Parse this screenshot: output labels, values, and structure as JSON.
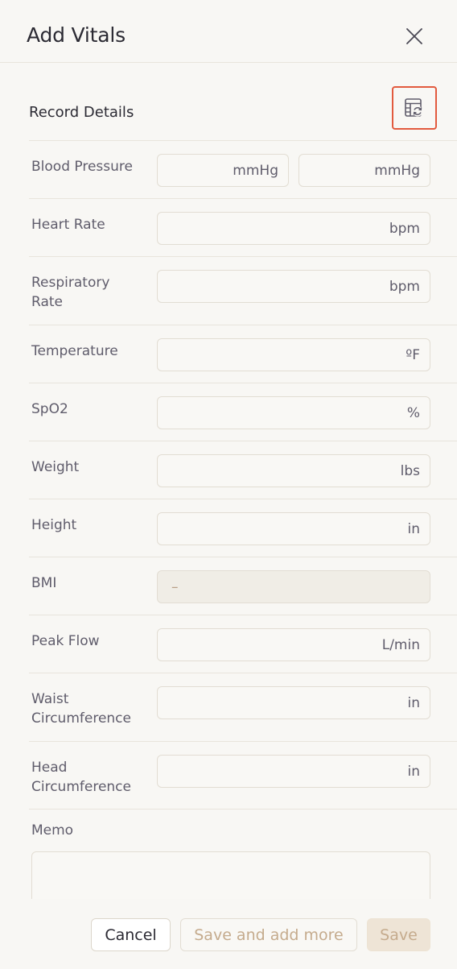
{
  "dialog": {
    "title": "Add Vitals",
    "close_icon": "close-icon"
  },
  "section": {
    "title": "Record Details",
    "refresh_icon": "table-refresh-icon"
  },
  "vitals": {
    "blood_pressure": {
      "label": "Blood Pressure",
      "unit_1": "mmHg",
      "unit_2": "mmHg"
    },
    "heart_rate": {
      "label": "Heart Rate",
      "unit": "bpm"
    },
    "respiratory_rate": {
      "label": "Respiratory Rate",
      "unit": "bpm"
    },
    "temperature": {
      "label": "Temperature",
      "unit": "ºF"
    },
    "spo2": {
      "label": "SpO2",
      "unit": "%"
    },
    "weight": {
      "label": "Weight",
      "unit": "lbs"
    },
    "height": {
      "label": "Height",
      "unit": "in"
    },
    "bmi": {
      "label": "BMI",
      "value": "–"
    },
    "peak_flow": {
      "label": "Peak Flow",
      "unit": "L/min"
    },
    "waist_circumference": {
      "label": "Waist Circumference",
      "unit": "in"
    },
    "head_circumference": {
      "label": "Head Circumference",
      "unit": "in"
    }
  },
  "memo": {
    "label": "Memo"
  },
  "footer": {
    "cancel_label": "Cancel",
    "save_and_add_more_label": "Save and add more",
    "save_label": "Save"
  },
  "colors": {
    "accent_outline": "#e25a3e",
    "disabled_text": "#c5ab8d"
  }
}
